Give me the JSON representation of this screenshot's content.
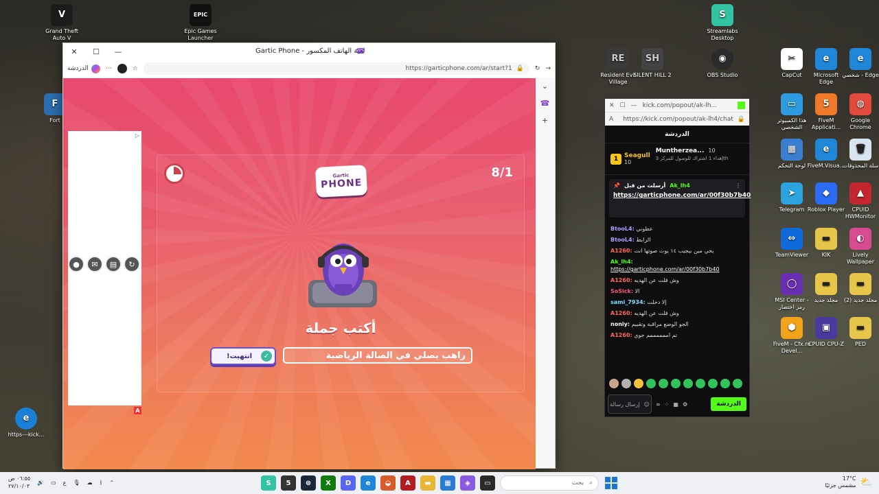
{
  "desktop": {
    "icons_left": [
      {
        "label": "Grand Theft Auto V",
        "glyph": "V",
        "color": "#1c1c1c"
      },
      {
        "label": "Epic Games Launcher",
        "glyph": "EPIC",
        "color": "#111111"
      },
      {
        "label": "Fort",
        "glyph": "F",
        "color": "#2a6fb0"
      },
      {
        "label": "https---kick...",
        "glyph": "e",
        "color": "#1a7fd6"
      }
    ],
    "icons_top": [
      {
        "label": "Streamlabs Desktop",
        "glyph": "S",
        "color": "#31c3a2"
      },
      {
        "label": "Resident Evil Village",
        "glyph": "RE",
        "color": "#3a3a3a"
      },
      {
        "label": "SILENT HILL 2",
        "glyph": "SH",
        "color": "#444444"
      },
      {
        "label": "OBS Studio",
        "glyph": "◉",
        "color": "#2b2b2b"
      }
    ],
    "icons_right": [
      {
        "label": "CapCut",
        "glyph": "✂",
        "color": "#ffffff"
      },
      {
        "label": "Microsoft Edge",
        "glyph": "e",
        "color": "#1f86d8"
      },
      {
        "label": "شخصي - Edge",
        "glyph": "e",
        "color": "#1f86d8"
      },
      {
        "label": "هذا الكمبيوتر الشخصي",
        "glyph": "▭",
        "color": "#2f9be0"
      },
      {
        "label": "FiveM Applicati...",
        "glyph": "5",
        "color": "#f0782a"
      },
      {
        "label": "Google Chrome",
        "glyph": "◍",
        "color": "#e24a3b"
      },
      {
        "label": "لوحة التحكم",
        "glyph": "▦",
        "color": "#3a7fcf"
      },
      {
        "label": "FiveM.Visua...",
        "glyph": "e",
        "color": "#1f86d8"
      },
      {
        "label": "سلة المحذوفات",
        "glyph": "🗑",
        "color": "#d8e4ee"
      },
      {
        "label": "Telegram",
        "glyph": "➤",
        "color": "#2aa3de"
      },
      {
        "label": "Roblox Player",
        "glyph": "◆",
        "color": "#2b6cf6"
      },
      {
        "label": "CPUID HWMonitor",
        "glyph": "▲",
        "color": "#c2262e"
      },
      {
        "label": "TeamViewer",
        "glyph": "⇔",
        "color": "#0e6ad8"
      },
      {
        "label": "KIK",
        "glyph": "▬",
        "color": "#e7c44a"
      },
      {
        "label": "Lively Wallpaper",
        "glyph": "◐",
        "color": "#d84b8f"
      },
      {
        "label": "MSI Center - رمز اختصار",
        "glyph": "◯",
        "color": "#6a2fb0"
      },
      {
        "label": "مجلد جديد",
        "glyph": "▬",
        "color": "#e7c44a"
      },
      {
        "label": "مجلد جديد (2)",
        "glyph": "▬",
        "color": "#e7c44a"
      },
      {
        "label": "FiveM - Cfx.re Devel...",
        "glyph": "⬢",
        "color": "#f2a21b"
      },
      {
        "label": "CPUID CPU-Z",
        "glyph": "▣",
        "color": "#4a3aa0"
      },
      {
        "label": "PED",
        "glyph": "▬",
        "color": "#e7c44a"
      }
    ]
  },
  "browser": {
    "title": "Gartic Phone - لعبة الهاتف المكسور",
    "url": "https://garticphone.com/ar/start?1",
    "chat_label": "الدردشة"
  },
  "game": {
    "round_counter": "8/1",
    "logo_top": "Gartic",
    "logo_main": "PHONE",
    "prompt_title": "أكتب جملة",
    "sentence_value": "راهب يصلي في الصالة الرياضية",
    "done_label": "!انتهيت",
    "ad_choices": "▷"
  },
  "chat": {
    "window_url": "kick.com/popout/ak-lh...",
    "address": "https://kick.com/popout/ak-lh4/chat",
    "header": "الدردشة",
    "gifter1": {
      "rank": "1",
      "name": "Seagull",
      "count": "10"
    },
    "gifter2": {
      "name": "Muntherzea...",
      "count": "10",
      "note": "إهداء 1 اشتراك للوصول للمركز 3th"
    },
    "pinned_by_label": "أرسلت من قبل",
    "pinned_user": "Ak_lh4",
    "pinned_link": "https://garticphone.com/ar/00f30b7b40",
    "messages": [
      {
        "user": "BtooL4:",
        "text": "عطوني",
        "color": "#b39dff"
      },
      {
        "user": "BtooL4:",
        "text": "الرابط",
        "color": "#b39dff"
      },
      {
        "user": "A1260:",
        "text": "يحي مين بيجيب ١٤ يوت صوتها انت",
        "color": "#ff6a4a"
      },
      {
        "user": "Ak_lh4:",
        "text": "https://garticphone.com/ar/00f30b7b40",
        "color": "#53fc18"
      },
      {
        "user": "A1260:",
        "text": "وش قلت عن الهديه",
        "color": "#ff6a4a"
      },
      {
        "user": "SoSick:",
        "text": "الا",
        "color": "#ff5577"
      },
      {
        "user": "sami_7934:",
        "text": "إلا دخلت",
        "color": "#7ee0ff"
      },
      {
        "user": "A1260:",
        "text": "وش قلت عن الهديه",
        "color": "#ff6a4a"
      },
      {
        "user": "noniy:",
        "text": "الجو الوضع مراقبة وتقييم",
        "color": "#ffffff"
      },
      {
        "user": "A1260:",
        "text": "تم اممممممم جوي",
        "color": "#ff6a4a"
      }
    ],
    "input_placeholder": "إرسال رسالة",
    "send_label": "الدردشة"
  },
  "taskbar": {
    "clock_time": "٠٦:٥٥ ص",
    "clock_date": "٢٧/١٠/٠٣",
    "search_placeholder": "بحث",
    "weather_temp": "17°C",
    "weather_text": "مشمس جزئيًا",
    "apps": [
      {
        "name": "streamlabs-app",
        "glyph": "S",
        "color": "#31c3a2"
      },
      {
        "name": "fivem-app",
        "glyph": "5",
        "color": "#333333"
      },
      {
        "name": "steam-app",
        "glyph": "⊛",
        "color": "#1b2838"
      },
      {
        "name": "xbox-app",
        "glyph": "X",
        "color": "#107c10"
      },
      {
        "name": "discord-app",
        "glyph": "D",
        "color": "#5865f2"
      },
      {
        "name": "edge-app",
        "glyph": "e",
        "color": "#1f86d8"
      },
      {
        "name": "capcut-app",
        "glyph": "◒",
        "color": "#d65a2a"
      },
      {
        "name": "acrobat-app",
        "glyph": "A",
        "color": "#b01e23"
      },
      {
        "name": "explorer-app",
        "glyph": "▬",
        "color": "#e7b735"
      },
      {
        "name": "store-app",
        "glyph": "▦",
        "color": "#2a7bd8"
      },
      {
        "name": "copilot-app",
        "glyph": "◈",
        "color": "#8a5be0"
      },
      {
        "name": "terminal-app",
        "glyph": "▭",
        "color": "#2a2a2a"
      }
    ]
  }
}
